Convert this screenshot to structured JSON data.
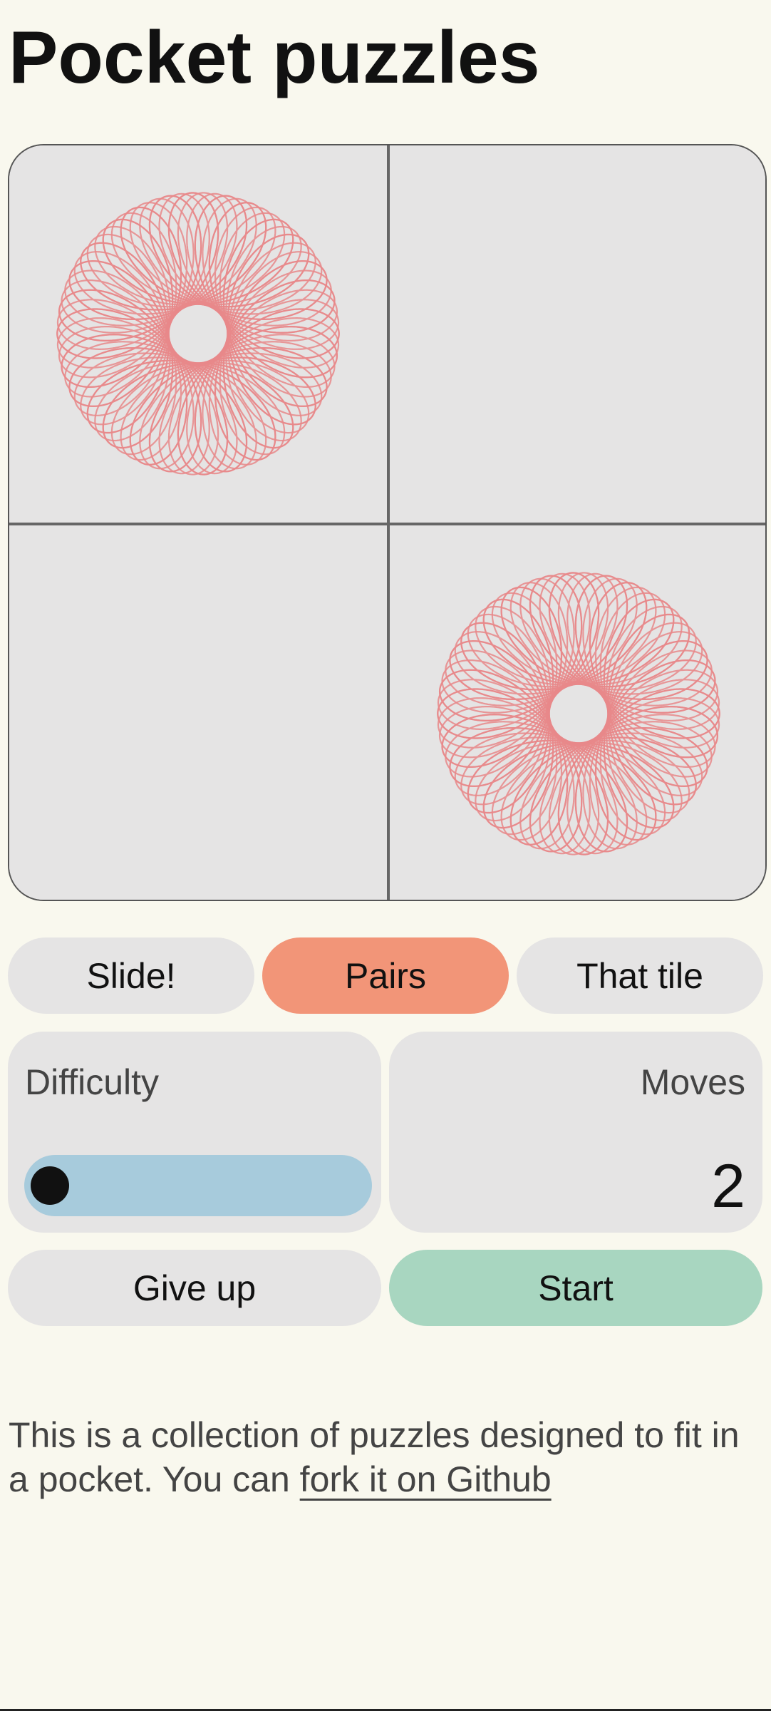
{
  "title": "Pocket puzzles",
  "colors": {
    "background": "#f9f8ee",
    "tile_background": "#e5e4e4",
    "pattern": "#e8888a",
    "active_mode": "#f29578",
    "slider_track": "#a7cbdc",
    "start_button": "#a8d6c0"
  },
  "board": {
    "tiles": [
      {
        "pattern": "spirograph-icon"
      },
      {
        "pattern": "empty"
      },
      {
        "pattern": "empty"
      },
      {
        "pattern": "spirograph-icon"
      }
    ]
  },
  "modes": [
    {
      "label": "Slide!",
      "active": false
    },
    {
      "label": "Pairs",
      "active": true
    },
    {
      "label": "That tile",
      "active": false
    }
  ],
  "difficulty": {
    "label": "Difficulty",
    "level": 0
  },
  "moves": {
    "label": "Moves",
    "value": "2"
  },
  "actions": {
    "give_up": "Give up",
    "start": "Start"
  },
  "footer": {
    "text": "This is a collection of puzzles designed to fit in a pocket. You can ",
    "link_text": "fork it on Github"
  }
}
